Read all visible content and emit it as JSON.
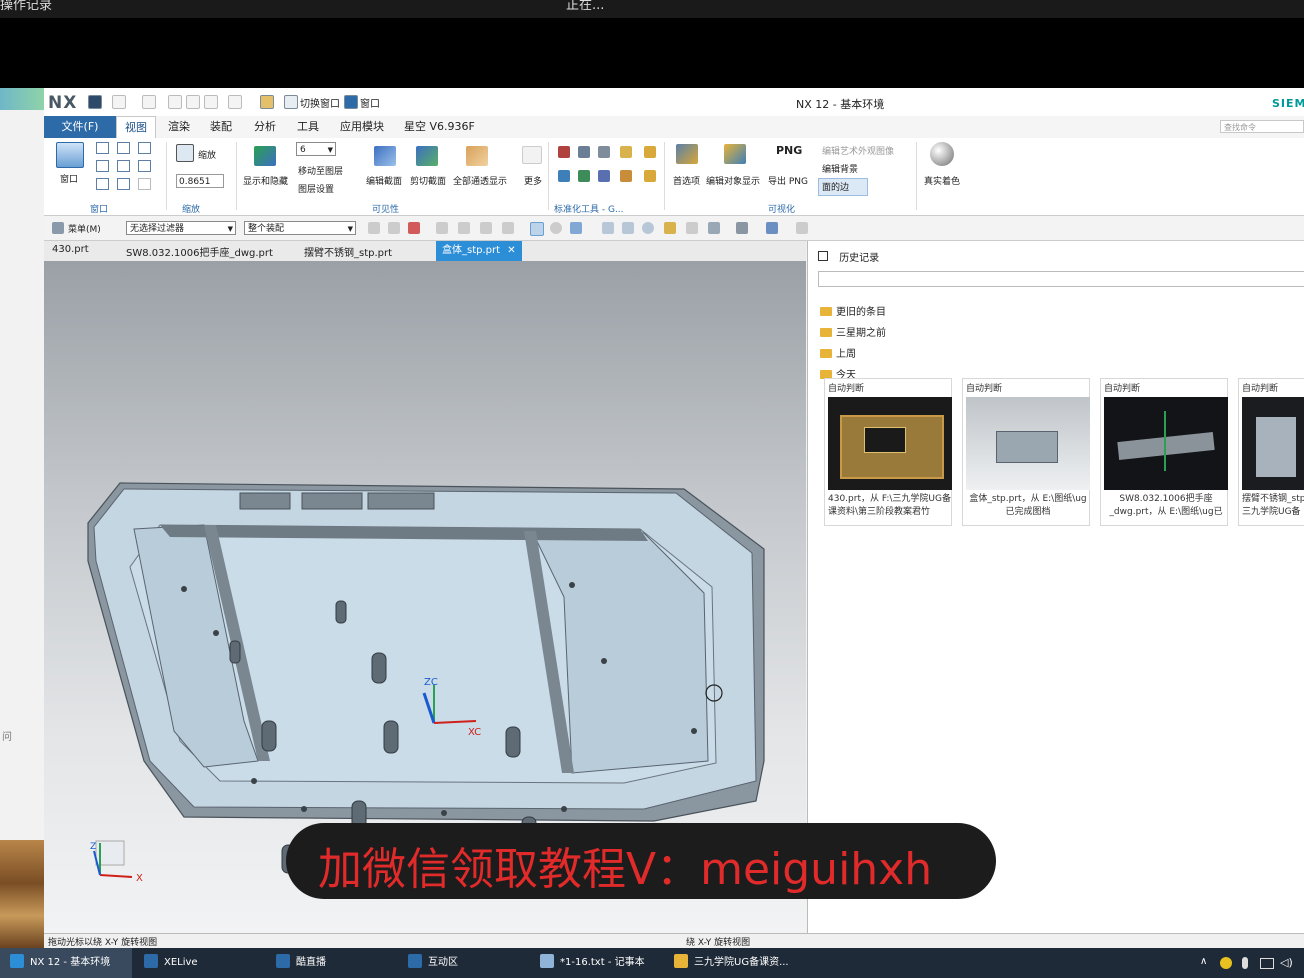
{
  "top_strip": {
    "left_text": "操作记录",
    "center_text": "正在..."
  },
  "window": {
    "logo": "NX",
    "title": "NX 12 - 基本环境",
    "vendor": "SIEMENS",
    "quick_access": {
      "switch_window": "切换窗口",
      "window_menu": "窗口"
    }
  },
  "ribbon_tabs": {
    "file": "文件(F)",
    "items": [
      "视图",
      "渲染",
      "装配",
      "分析",
      "工具",
      "应用模块",
      "星空 V6.936F"
    ],
    "active": "视图",
    "search_placeholder": "查找命令"
  },
  "ribbon": {
    "window_group": {
      "label": "窗口",
      "btn": "窗口"
    },
    "zoom_group": {
      "label": "缩放",
      "btn": "缩放",
      "value": "0.8651"
    },
    "visibility_group": {
      "label": "可见性",
      "layer_value": "6",
      "show_hide": "显示和隐藏",
      "move_to_layer": "移动至图层",
      "layer_settings": "图层设置",
      "edit_section": "编辑截面",
      "clip_section": "剪切截面",
      "show_all": "全部通透显示",
      "more": "更多"
    },
    "std_tools_label": "标准化工具 - G...",
    "visualization_group": {
      "label": "可视化",
      "preferences": "首选项",
      "edit_object_display": "编辑对象显示",
      "export_png": "导出 PNG",
      "png_label": "PNG",
      "art_appearance": "编辑艺术外观图像",
      "edit_background": "编辑背景",
      "face_edges": "面的边",
      "true_shading": "真实着色"
    }
  },
  "toolbar2": {
    "menu": "菜单(M)",
    "filter": "无选择过滤器",
    "assembly": "整个装配"
  },
  "file_tabs": [
    {
      "label": "430.prt",
      "active": false
    },
    {
      "label": "SW8.032.1006把手座_dwg.prt",
      "active": false
    },
    {
      "label": "摆臂不锈钢_stp.prt",
      "active": false
    },
    {
      "label": "盒体_stp.prt",
      "active": true
    }
  ],
  "viewport": {
    "axis_zc": "ZC",
    "axis_xc": "XC",
    "triad_x": "X",
    "triad_z": "Z"
  },
  "history_panel": {
    "title": "历史记录",
    "folders": [
      "更旧的条目",
      "三星期之前",
      "上周",
      "今天"
    ],
    "cards": [
      {
        "header": "自动判断",
        "caption": "430.prt，从 F:\\三九学院UG备课资料\\第三阶段教案君竹"
      },
      {
        "header": "自动判断",
        "caption": "盒体_stp.prt，从 E:\\图纸\\ug已完成图档"
      },
      {
        "header": "自动判断",
        "caption": "SW8.032.1006把手座_dwg.prt，从 E:\\图纸\\ug已"
      },
      {
        "header": "自动判断",
        "caption": "摆臂不锈钢_stp三九学院UG备"
      }
    ]
  },
  "status_bar": {
    "left": "拖动光标以绕 X-Y 旋转视图",
    "center": "绕 X-Y 旋转视图"
  },
  "overlay_banner": "加微信领取教程V：meiguihxh",
  "taskbar": {
    "items": [
      "NX 12 - 基本环境",
      "XELive",
      "酷直播",
      "互动区",
      "*1-16.txt - 记事本",
      "三九学院UG备课资..."
    ]
  },
  "left_desktop": {
    "side_text": "问"
  }
}
